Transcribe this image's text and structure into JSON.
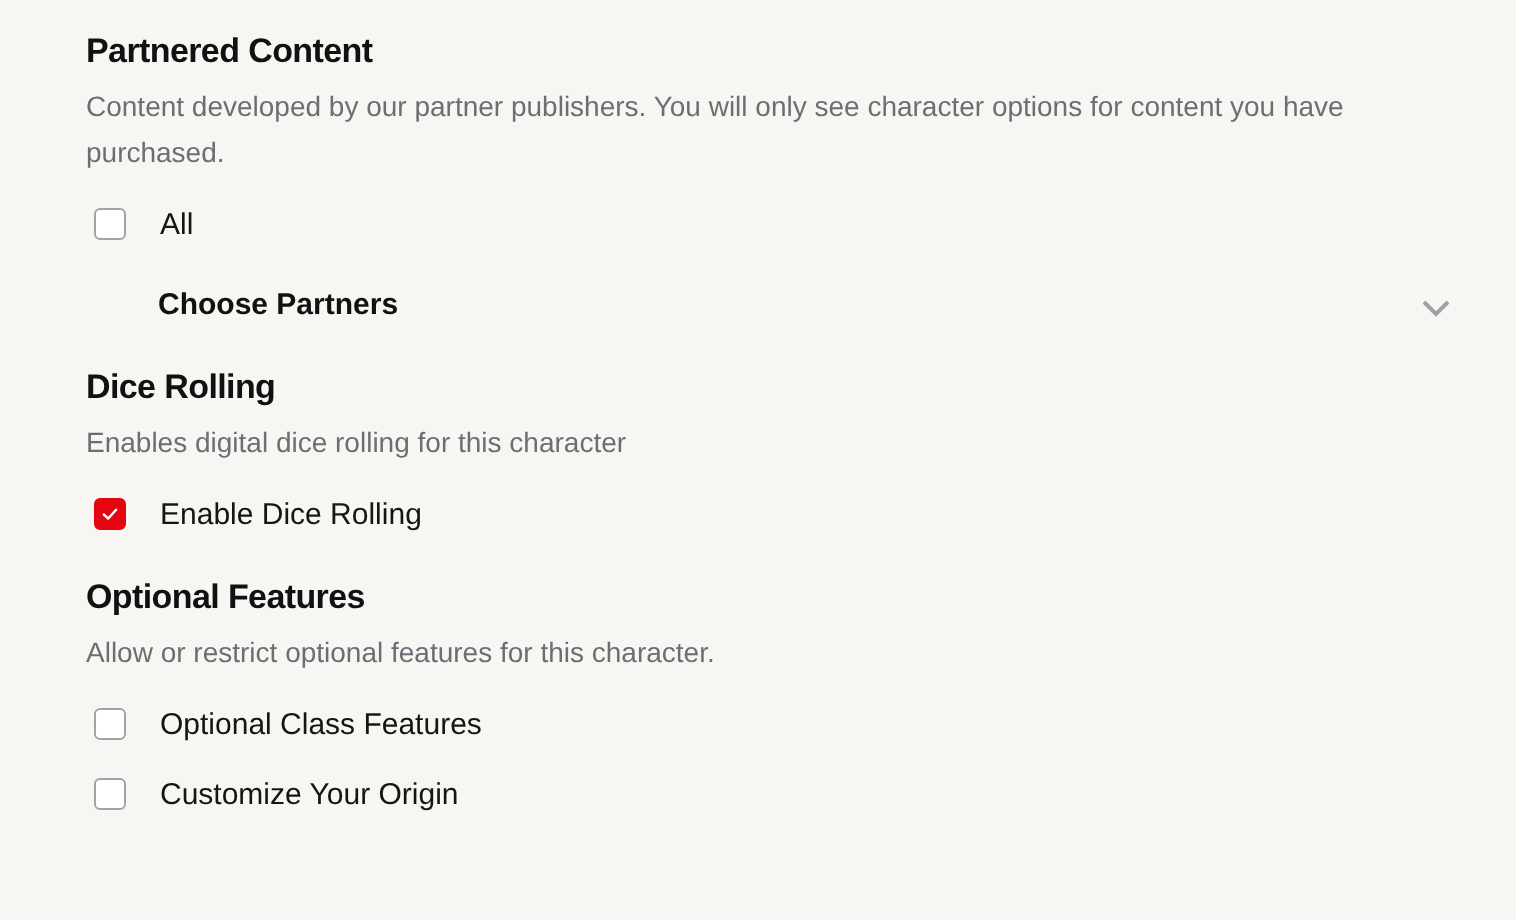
{
  "sections": [
    {
      "title": "Partnered Content",
      "description": "Content developed by our partner publishers. You will only see character options for content you have purchased.",
      "options": [
        {
          "label": "All",
          "checked": false
        }
      ],
      "dropdown": {
        "label": "Choose Partners",
        "expanded": false
      }
    },
    {
      "title": "Dice Rolling",
      "description": "Enables digital dice rolling for this character",
      "options": [
        {
          "label": "Enable Dice Rolling",
          "checked": true
        }
      ]
    },
    {
      "title": "Optional Features",
      "description": "Allow or restrict optional features for this character.",
      "options": [
        {
          "label": "Optional Class Features",
          "checked": false
        },
        {
          "label": "Customize Your Origin",
          "checked": false
        }
      ]
    }
  ]
}
